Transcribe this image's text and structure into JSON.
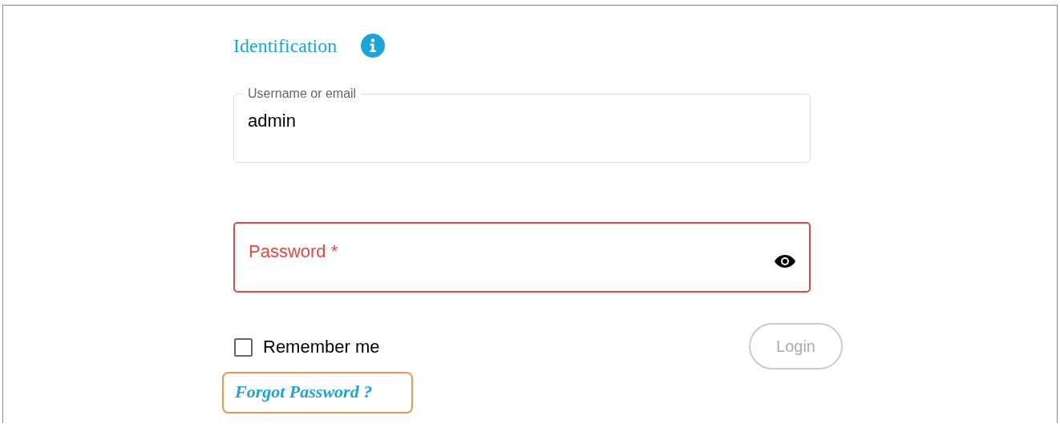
{
  "heading": "Identification",
  "username_field": {
    "label": "Username or email",
    "value": "admin"
  },
  "password_field": {
    "label": "Password *",
    "invalid": true
  },
  "remember_me": {
    "label": "Remember me",
    "checked": false
  },
  "login_button": {
    "label": "Login",
    "disabled": true
  },
  "forgot_link": {
    "label": "Forgot Password ?",
    "highlighted": true
  }
}
